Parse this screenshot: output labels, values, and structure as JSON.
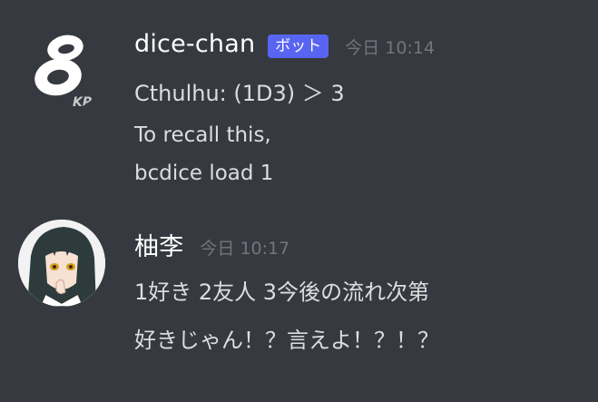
{
  "messages": [
    {
      "author": "dice-chan",
      "badge": "ボット",
      "timestamp": "今日 10:14",
      "avatar_icon": "dice-bot-logo-icon",
      "avatar_text": "KP",
      "lines": [
        "Cthulhu: (1D3) ＞ 3",
        "To recall this,",
        "bcdice load 1"
      ]
    },
    {
      "author": "柚李",
      "timestamp": "今日 10:17",
      "avatar_icon": "anime-character-avatar-icon",
      "lines": [
        "1好き 2友人 3今後の流れ次第",
        "好きじゃん！？言えよ！？！？"
      ]
    }
  ],
  "colors": {
    "background": "#36393f",
    "username": "#ffffff",
    "text": "#dcddde",
    "timestamp": "#72767d",
    "bot_badge": "#5865f2"
  }
}
